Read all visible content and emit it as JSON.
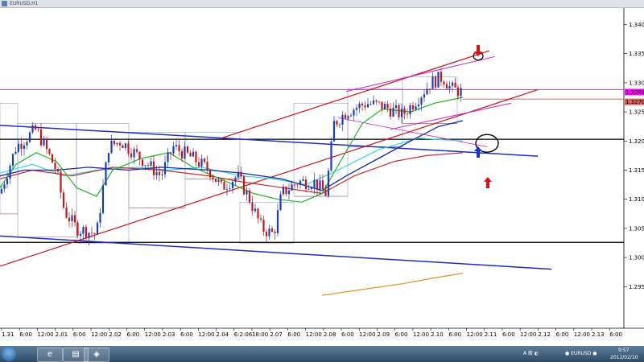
{
  "window": {
    "title": "EURUSD,H1"
  },
  "chart_data": {
    "type": "line",
    "symbol": "EURUSD",
    "price_ticks": [
      "1.3400",
      "1.3350",
      "1.3300",
      "1.3250",
      "1.3200",
      "1.3150",
      "1.3100",
      "1.3050",
      "1.3000",
      "1.2950"
    ],
    "price_labels_box": [
      {
        "text": "1.3284",
        "color": "#ff00ff"
      },
      {
        "text": "1.3270",
        "color": "#e06060"
      }
    ],
    "time_ticks": [
      "1.31",
      "6:00",
      "12:00",
      "2.01",
      "6:00",
      "12:00",
      "2.02",
      "6:00",
      "12:00",
      "2.03",
      "6:00",
      "12:00",
      "2.04",
      "6:2:06",
      "18:00",
      "2.07",
      "6:00",
      "12:00",
      "2.08",
      "6:00",
      "12:00",
      "2.09",
      "6:00",
      "12:00",
      "2.10",
      "6:00",
      "12:00",
      "2.11",
      "6:00",
      "12:00",
      "2.12",
      "6:00",
      "12:00",
      "2.13",
      "6:00"
    ],
    "last_price": 1.3284,
    "ylim": [
      1.2925,
      1.3425
    ],
    "colors": {
      "up_candle": "#1a3fb5",
      "down_candle": "#c2161b",
      "ma_green": "#1fb81f",
      "ma_blue": "#1828a8",
      "ma_cyan": "#34d8e0",
      "ma_red": "#c92b2b",
      "ma_orange": "#e8901e",
      "channel_blue": "#1a2fbe",
      "channel_red": "#d01010",
      "channel_magenta": "#cc22cc",
      "box": "#8aa0c8"
    }
  },
  "taskbar": {
    "apps": [
      "ie-icon",
      "explorer-icon",
      "mt4-icon"
    ],
    "tray_text": [
      "A 般 ◐",
      "● EURUSD ● ",
      "9:57",
      "2012/02/10"
    ]
  }
}
